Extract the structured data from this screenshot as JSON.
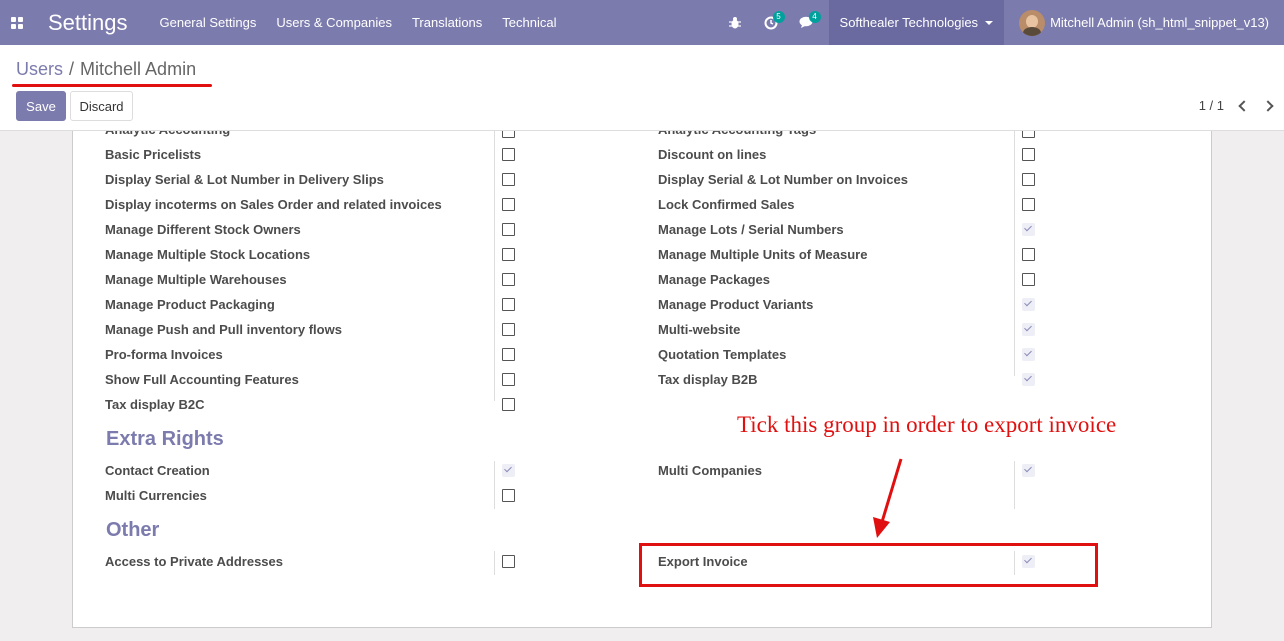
{
  "navbar": {
    "brand": "Settings",
    "menu": [
      "General Settings",
      "Users & Companies",
      "Translations",
      "Technical"
    ],
    "activities_count": "5",
    "messages_count": "4",
    "company": "Softhealer Technologies",
    "user": "Mitchell Admin (sh_html_snippet_v13)"
  },
  "breadcrumb": {
    "parent": "Users",
    "separator": "/",
    "current": "Mitchell Admin"
  },
  "buttons": {
    "save": "Save",
    "discard": "Discard"
  },
  "pager": {
    "value": "1 / 1"
  },
  "groups": {
    "top_partial_left": "Analytic Accounting",
    "top_partial_right": "Analytic Accounting Tags",
    "left": [
      {
        "label": "Basic Pricelists",
        "checked": false
      },
      {
        "label": "Display Serial & Lot Number in Delivery Slips",
        "checked": false
      },
      {
        "label": "Display incoterms on Sales Order and related invoices",
        "checked": false
      },
      {
        "label": "Manage Different Stock Owners",
        "checked": false
      },
      {
        "label": "Manage Multiple Stock Locations",
        "checked": false
      },
      {
        "label": "Manage Multiple Warehouses",
        "checked": false
      },
      {
        "label": "Manage Product Packaging",
        "checked": false
      },
      {
        "label": "Manage Push and Pull inventory flows",
        "checked": false
      },
      {
        "label": "Pro-forma Invoices",
        "checked": false
      },
      {
        "label": "Show Full Accounting Features",
        "checked": false
      },
      {
        "label": "Tax display B2C",
        "checked": false
      }
    ],
    "right": [
      {
        "label": "Discount on lines",
        "checked": false
      },
      {
        "label": "Display Serial & Lot Number on Invoices",
        "checked": false
      },
      {
        "label": "Lock Confirmed Sales",
        "checked": false
      },
      {
        "label": "Manage Lots / Serial Numbers",
        "checked": true
      },
      {
        "label": "Manage Multiple Units of Measure",
        "checked": false
      },
      {
        "label": "Manage Packages",
        "checked": false
      },
      {
        "label": "Manage Product Variants",
        "checked": true
      },
      {
        "label": "Multi-website",
        "checked": true
      },
      {
        "label": "Quotation Templates",
        "checked": true
      },
      {
        "label": "Tax display B2B",
        "checked": true
      }
    ]
  },
  "extra_rights": {
    "title": "Extra Rights",
    "left": [
      {
        "label": "Contact Creation",
        "checked": true
      },
      {
        "label": "Multi Currencies",
        "checked": false
      }
    ],
    "right": [
      {
        "label": "Multi Companies",
        "checked": true
      }
    ]
  },
  "other": {
    "title": "Other",
    "left": [
      {
        "label": "Access to Private Addresses",
        "checked": false
      }
    ],
    "right": [
      {
        "label": "Export Invoice",
        "checked": true
      }
    ]
  },
  "annotation": {
    "text": "Tick this group in order to export invoice",
    "color": "#e01010"
  },
  "colors": {
    "brand": "#7c7bad",
    "annotation": "#e01010"
  }
}
